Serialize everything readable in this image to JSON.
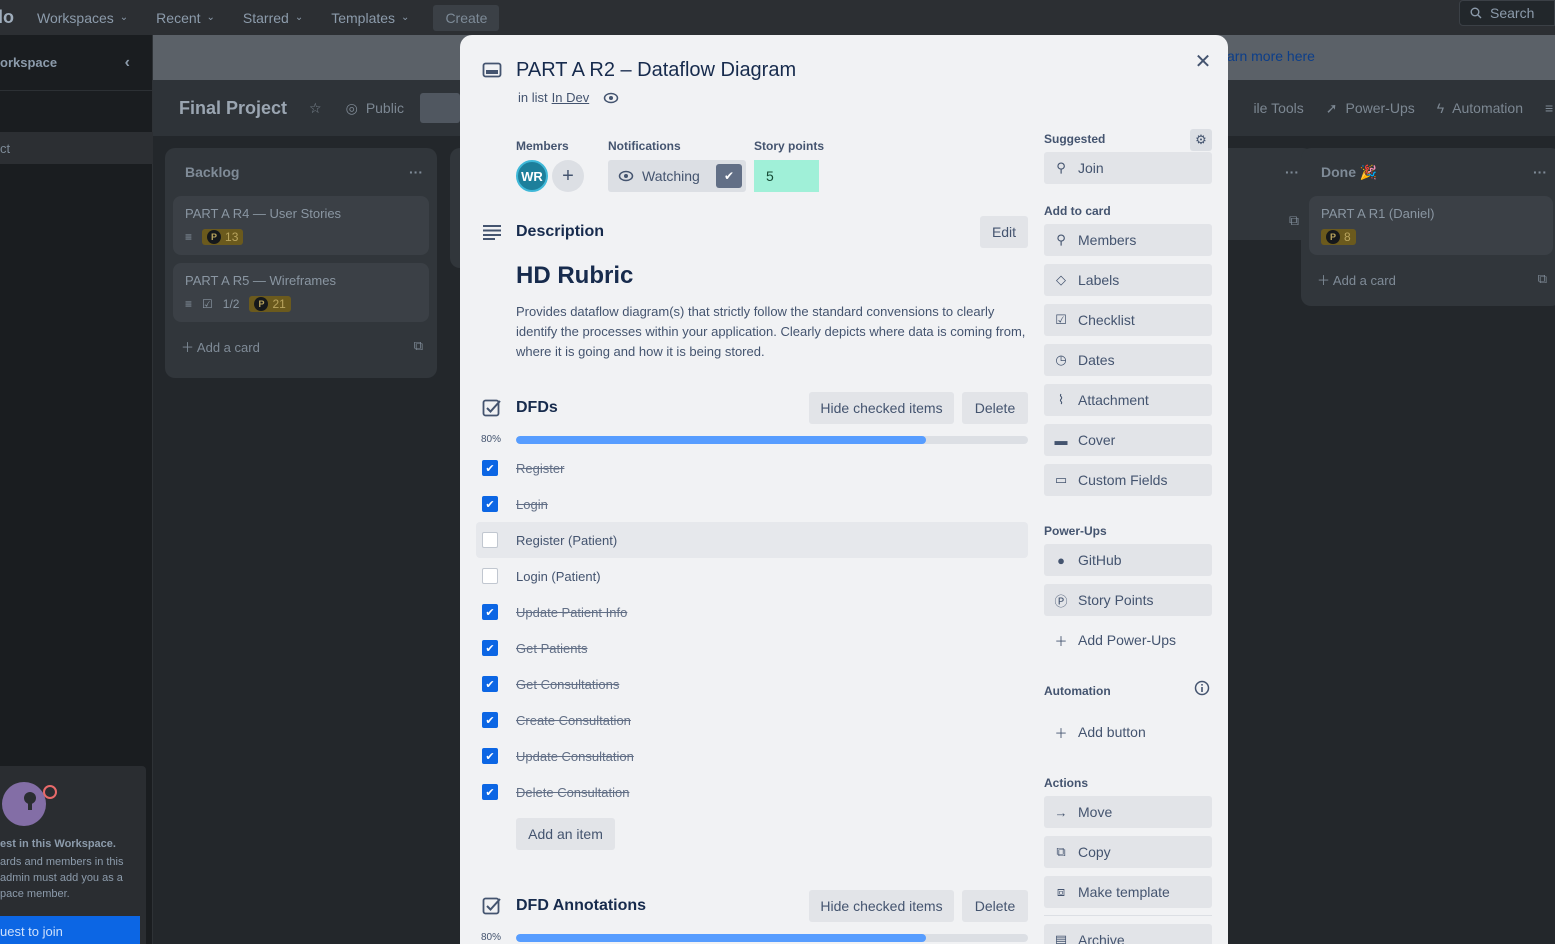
{
  "topbar": {
    "logo": "lo",
    "nav": [
      "Workspaces",
      "Recent",
      "Starred",
      "Templates"
    ],
    "create": "Create",
    "search": "Search"
  },
  "sidebar": {
    "workspace": "orkspace",
    "active_item": "ct",
    "invite_title": "est in this Workspace.",
    "invite_text": "ards and members in this admin must add you as a pace member.",
    "invite_button": "uest to join"
  },
  "banner": {
    "learn_more": "arn more here"
  },
  "board": {
    "title": "Final Project",
    "visibility": "Public",
    "right_items": [
      "ile Tools",
      "Power-Ups",
      "Automation"
    ]
  },
  "lists": {
    "backlog": {
      "title": "Backlog",
      "cards": [
        {
          "title": "PART A R4 — User Stories",
          "points": "13"
        },
        {
          "title": "PART A R5 — Wireframes",
          "checklist": "1/2",
          "points": "21"
        }
      ],
      "add": "Add a card"
    },
    "done": {
      "title": "Done",
      "cards": [
        {
          "title": "PART A R1 (Daniel)",
          "points": "8"
        }
      ],
      "add": "Add a card"
    }
  },
  "modal": {
    "title": "PART A R2 – Dataflow Diagram",
    "in_list_prefix": "in list",
    "list_name": "In Dev",
    "members_label": "Members",
    "member_initials": "WR",
    "notifications_label": "Notifications",
    "watching": "Watching",
    "story_points_label": "Story points",
    "story_points": "5",
    "description": {
      "title": "Description",
      "edit": "Edit",
      "heading": "HD Rubric",
      "body": "Provides dataflow diagram(s) that strictly follow the standard convensions to clearly identify the processes within your application. Clearly depicts where data is coming from, where it is going and how it is being stored."
    },
    "checklists": [
      {
        "title": "DFDs",
        "hide": "Hide checked items",
        "delete": "Delete",
        "percent_label": "80%",
        "progress": 0.8,
        "items": [
          {
            "text": "Register",
            "checked": true
          },
          {
            "text": "Login",
            "checked": true
          },
          {
            "text": "Register (Patient)",
            "checked": false
          },
          {
            "text": "Login (Patient)",
            "checked": false
          },
          {
            "text": "Update Patient Info",
            "checked": true
          },
          {
            "text": "Get Patients",
            "checked": true
          },
          {
            "text": "Get Consultations",
            "checked": true
          },
          {
            "text": "Create Consultation",
            "checked": true
          },
          {
            "text": "Update Consultation",
            "checked": true
          },
          {
            "text": "Delete Consultation",
            "checked": true
          }
        ],
        "add_item": "Add an item"
      },
      {
        "title": "DFD Annotations",
        "hide": "Hide checked items",
        "delete": "Delete",
        "percent_label": "80%",
        "progress": 0.8
      }
    ],
    "suggested": {
      "label": "Suggested",
      "join": "Join"
    },
    "add_to_card": {
      "label": "Add to card",
      "items": [
        "Members",
        "Labels",
        "Checklist",
        "Dates",
        "Attachment",
        "Cover",
        "Custom Fields"
      ]
    },
    "power_ups": {
      "label": "Power-Ups",
      "items": [
        "GitHub",
        "Story Points"
      ],
      "add": "Add Power-Ups"
    },
    "automation": {
      "label": "Automation",
      "add_button": "Add button"
    },
    "actions": {
      "label": "Actions",
      "items": [
        "Move",
        "Copy",
        "Make template",
        "Archive"
      ]
    }
  }
}
